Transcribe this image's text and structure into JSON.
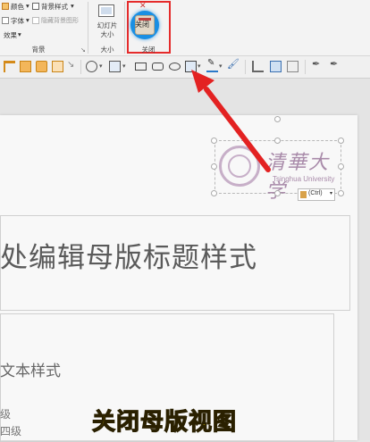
{
  "ribbon": {
    "colors_label": "颜色",
    "fonts_label": "字体",
    "effects_label": "效果",
    "bg_styles_label": "背景样式",
    "hide_bg_label": "隐藏背景图形",
    "bg_group_label": "背景",
    "slide_size_label_1": "幻灯片",
    "slide_size_label_2": "大小",
    "size_group_label": "大小",
    "close_button_label": "关闭",
    "close_group_label": "关闭",
    "highlight_color": "#e52b2b",
    "cursor_color": "#1a8fe3"
  },
  "toolbar": {
    "icons": [
      "align-left-icon",
      "align-center-icon",
      "align-right-icon",
      "align-justify-icon",
      "shapes-icon",
      "shape-dropdown-icon",
      "rectangle-icon",
      "rounded-rectangle-icon",
      "oval-icon",
      "shape-fill-icon",
      "pen-icon",
      "format-painter-icon",
      "crop-icon",
      "picture-icon",
      "picture-format-icon",
      "eyedropper-icon",
      "eyedropper-2-icon"
    ]
  },
  "slide": {
    "title_text": "处编辑母版标题样式",
    "body_text": "文本样式",
    "level_3": "级",
    "level_4": "四级",
    "logo_text": "清華大学",
    "logo_subtext": "Tsinghua University",
    "paste_tag": "(Ctrl)"
  },
  "annotation": {
    "caption": "关闭母版视图",
    "arrow_color": "#e32222",
    "caption_color": "#ffe000"
  }
}
